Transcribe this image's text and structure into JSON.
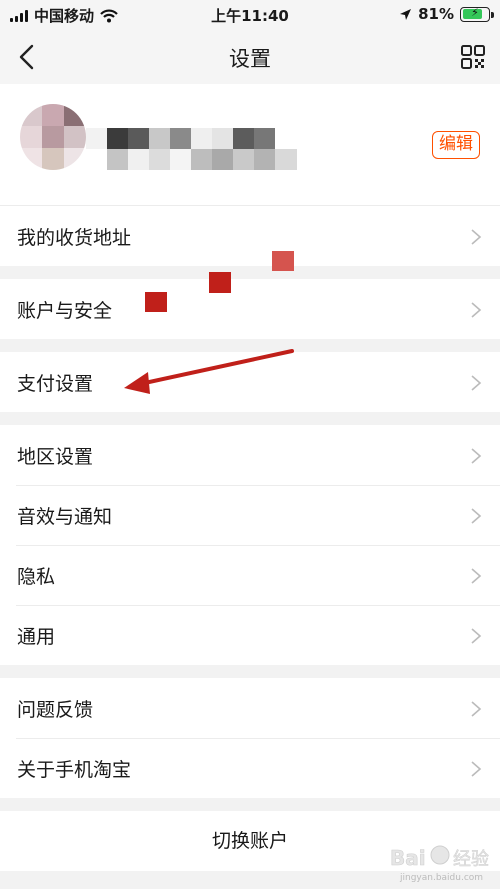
{
  "status_bar": {
    "carrier": "中国移动",
    "time": "上午11:40",
    "battery_percent": "81%",
    "battery_level": 0.81
  },
  "nav": {
    "title": "设置",
    "back_icon": "chevron-left-icon",
    "qr_icon": "qr-code-icon"
  },
  "profile": {
    "edit_label": "编辑",
    "accent": "#ff5000"
  },
  "groups": [
    {
      "items": [
        {
          "label": "我的收货地址"
        }
      ]
    },
    {
      "items": [
        {
          "label": "账户与安全"
        }
      ]
    },
    {
      "items": [
        {
          "label": "支付设置"
        }
      ]
    },
    {
      "items": [
        {
          "label": "地区设置"
        },
        {
          "label": "音效与通知"
        },
        {
          "label": "隐私"
        },
        {
          "label": "通用"
        }
      ]
    },
    {
      "items": [
        {
          "label": "问题反馈"
        },
        {
          "label": "关于手机淘宝"
        }
      ]
    }
  ],
  "switch_account_label": "切换账户",
  "annotation": {
    "color": "#c0201a"
  },
  "watermark": {
    "url": "jingyan.baidu.com"
  }
}
